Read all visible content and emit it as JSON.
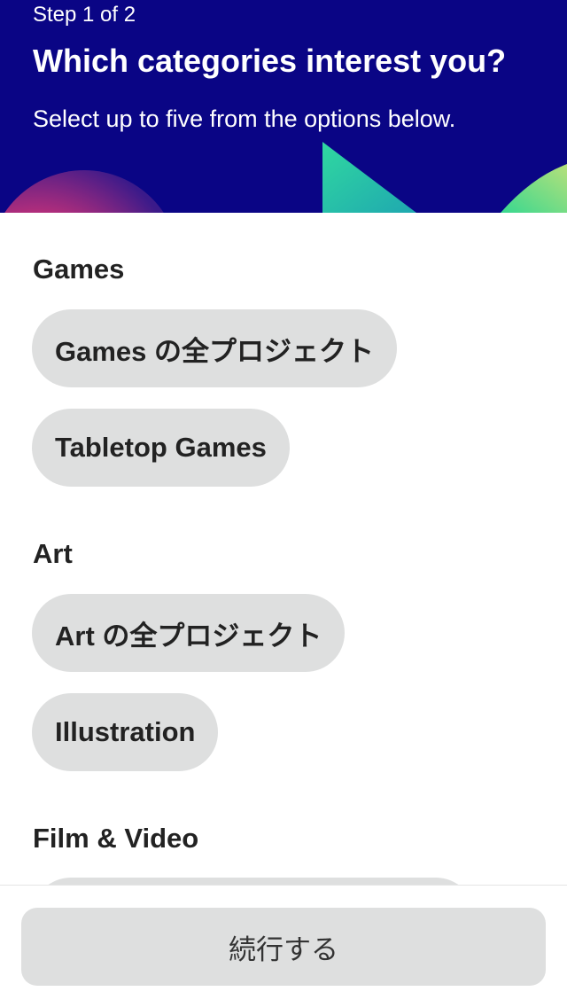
{
  "header": {
    "step": "Step 1 of 2",
    "title": "Which categories interest you?",
    "subtitle": "Select up to five from the options below.",
    "background_color": "#0a0585"
  },
  "sections": [
    {
      "title": "Games",
      "chips": [
        "Games の全プロジェクト",
        "Tabletop Games"
      ]
    },
    {
      "title": "Art",
      "chips": [
        "Art の全プロジェクト",
        "Illustration"
      ]
    },
    {
      "title": "Film & Video",
      "chips": []
    }
  ],
  "footer": {
    "continue_label": "続行する"
  },
  "colors": {
    "chip_bg": "#dedfdf",
    "text": "#222222"
  }
}
